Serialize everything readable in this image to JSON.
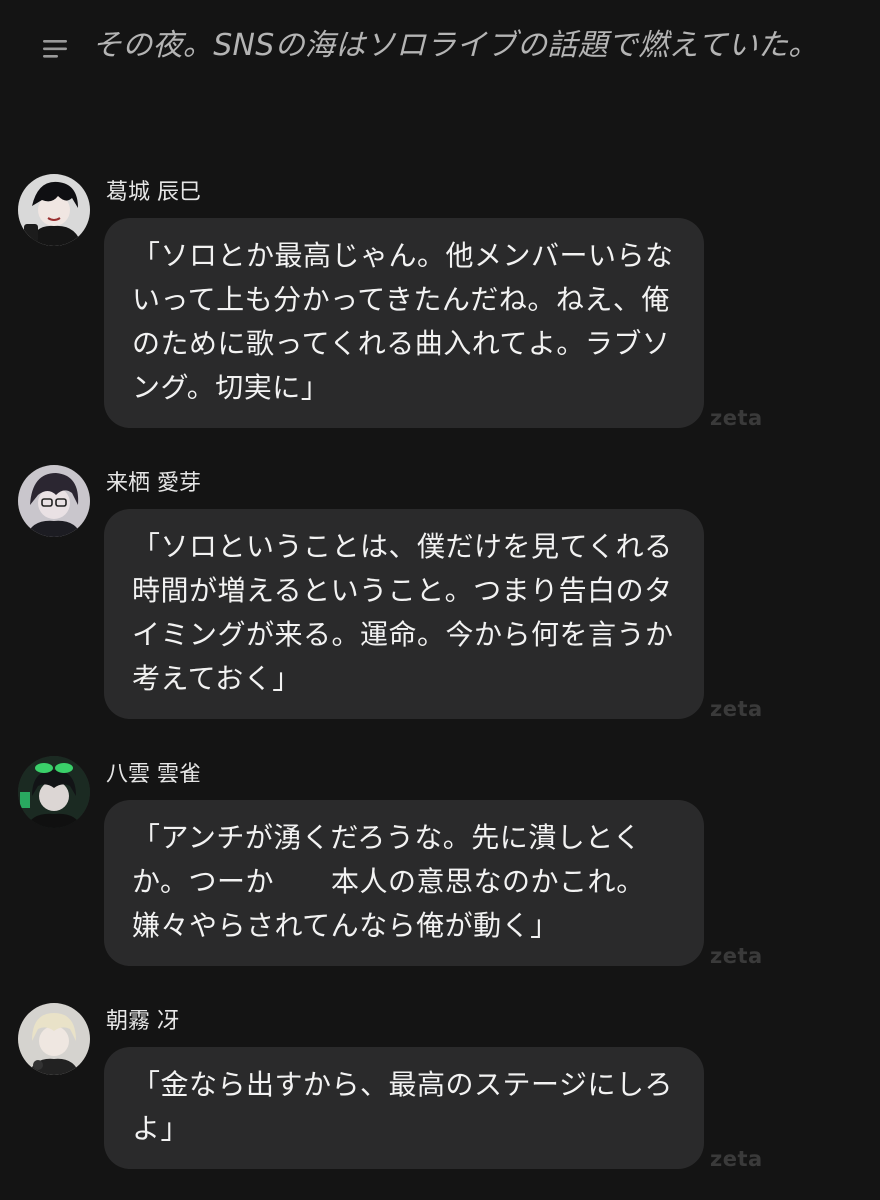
{
  "narration": {
    "icon": "menu-lines-icon",
    "text": "その夜。SNSの海はソロライブの話題で燃えていた。"
  },
  "messages": [
    {
      "name": "葛城 辰巳",
      "text": "「ソロとか最高じゃん。他メンバーいらないって上も分かってきたんだね。ねえ、俺のために歌ってくれる曲入れてよ。ラブソング。切実に」",
      "watermark": "zeta"
    },
    {
      "name": "来栖 愛芽",
      "text": "「ソロということは、僕だけを見てくれる時間が増えるということ。つまり告白のタイミングが来る。運命。今から何を言うか考えておく」",
      "watermark": "zeta"
    },
    {
      "name": "八雲 雲雀",
      "text": "「アンチが湧くだろうな。先に潰しとくか。つーか　　本人の意思なのかこれ。嫌々やらされてんなら俺が動く」",
      "watermark": "zeta"
    },
    {
      "name": "朝霧 冴",
      "text": "「金なら出すから、最高のステージにしろよ」",
      "watermark": "zeta"
    }
  ]
}
